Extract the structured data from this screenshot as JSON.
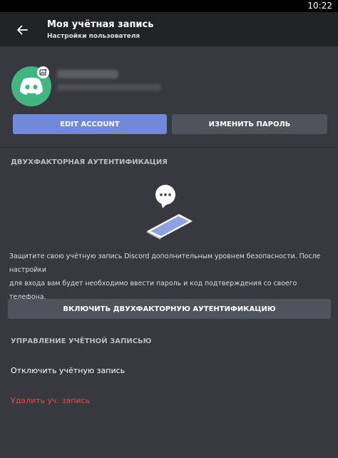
{
  "status_bar": {
    "time": "10:22"
  },
  "header": {
    "title": "Моя учётная запись",
    "subtitle": "Настройки пользователя"
  },
  "buttons": {
    "edit_account": "EDIT ACCOUNT",
    "change_password": "ИЗМЕНИТЬ ПАРОЛЬ"
  },
  "two_factor": {
    "section_title": "ДВУХФАКТОРНАЯ АУТЕНТИФИКАЦИЯ",
    "description_line1": "Защитите свою учётную запись Discord дополнительным уровнем безопасности. После",
    "description_line2": "настройки",
    "description_line3": "для входа вам будет необходимо ввести пароль и код подтверждения со своего телефона.",
    "enable_button": "ВКЛЮЧИТЬ ДВУХФАКТОРНУЮ АУТЕНТИФИКАЦИЮ"
  },
  "account_management": {
    "section_title": "УПРАВЛЕНИЕ УЧЁТНОЙ ЗАПИСЬЮ",
    "disable_account": "Отключить учётную запись",
    "delete_account": "Удалить уч. запись"
  },
  "colors": {
    "background": "#36393f",
    "appbar": "#202225",
    "accent": "#7289da",
    "avatar": "#43b581",
    "danger": "#f04747"
  },
  "icons": {
    "back": "arrow-left-icon",
    "avatar_edit": "image-edit-icon",
    "illustration": "phone-chat-icon"
  }
}
